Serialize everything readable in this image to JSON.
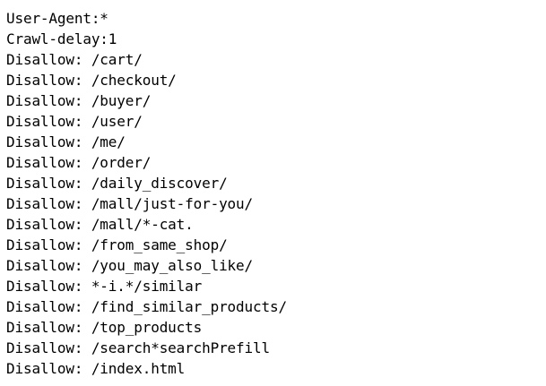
{
  "document": {
    "lines": [
      "User-Agent:*",
      "Crawl-delay:1",
      "Disallow: /cart/",
      "Disallow: /checkout/",
      "Disallow: /buyer/",
      "Disallow: /user/",
      "Disallow: /me/",
      "Disallow: /order/",
      "Disallow: /daily_discover/",
      "Disallow: /mall/just-for-you/",
      "Disallow: /mall/*-cat.",
      "Disallow: /from_same_shop/",
      "Disallow: /you_may_also_like/",
      "Disallow: *-i.*/similar",
      "Disallow: /find_similar_products/",
      "Disallow: /top_products",
      "Disallow: /search*searchPrefill",
      "Disallow: /index.html"
    ]
  }
}
